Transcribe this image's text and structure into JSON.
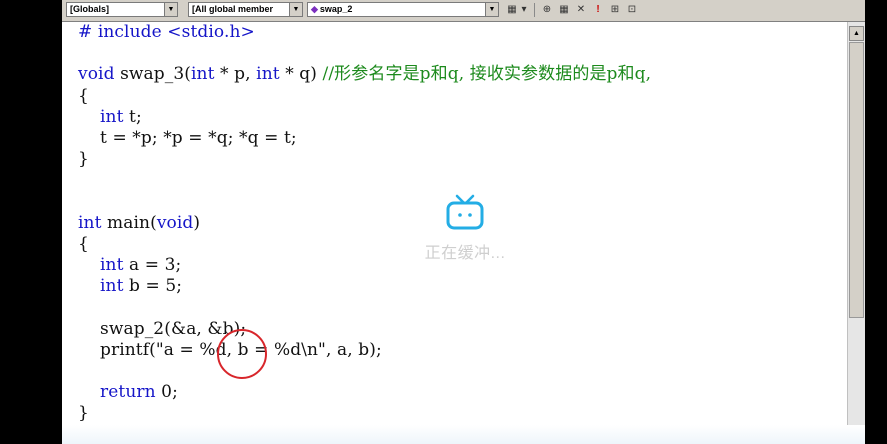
{
  "toolbar": {
    "scope_combo": "[Globals]",
    "members_combo": "[All global member",
    "function_combo": "swap_2",
    "dropdown_glyph": "▼",
    "function_icon_glyph": "◆",
    "dropdown_btn_glyph": "▾",
    "btn_glyphs": [
      "⊕",
      "▦",
      "✕",
      "!",
      "⊞",
      "⊡"
    ]
  },
  "editor": {
    "code_lines": [
      [
        {
          "t": "# include <stdio.h>",
          "k": "kw"
        }
      ],
      [
        {
          "t": "",
          "k": ""
        }
      ],
      [
        {
          "t": "void",
          "k": "kw"
        },
        {
          "t": " swap_3(",
          "k": ""
        },
        {
          "t": "int",
          "k": "kw"
        },
        {
          "t": " * p, ",
          "k": ""
        },
        {
          "t": "int",
          "k": "kw"
        },
        {
          "t": " * q) ",
          "k": ""
        },
        {
          "t": "//形参名字是p和q, 接收实参数据的是p和q,",
          "k": "cm"
        }
      ],
      [
        {
          "t": "{",
          "k": ""
        }
      ],
      [
        {
          "t": "    ",
          "k": ""
        },
        {
          "t": "int",
          "k": "kw"
        },
        {
          "t": " t;",
          "k": ""
        }
      ],
      [
        {
          "t": "    t = *p; *p = *q; *q = t;",
          "k": ""
        }
      ],
      [
        {
          "t": "}",
          "k": ""
        }
      ],
      [
        {
          "t": "",
          "k": ""
        }
      ],
      [
        {
          "t": "",
          "k": ""
        }
      ],
      [
        {
          "t": "int",
          "k": "kw"
        },
        {
          "t": " main(",
          "k": ""
        },
        {
          "t": "void",
          "k": "kw"
        },
        {
          "t": ")",
          "k": ""
        }
      ],
      [
        {
          "t": "{",
          "k": ""
        }
      ],
      [
        {
          "t": "    ",
          "k": ""
        },
        {
          "t": "int",
          "k": "kw"
        },
        {
          "t": " a = 3;",
          "k": ""
        }
      ],
      [
        {
          "t": "    ",
          "k": ""
        },
        {
          "t": "int",
          "k": "kw"
        },
        {
          "t": " b = 5;",
          "k": ""
        }
      ],
      [
        {
          "t": "",
          "k": ""
        }
      ],
      [
        {
          "t": "    swap_2(&a, &b);",
          "k": ""
        }
      ],
      [
        {
          "t": "    printf(\"a = %d, b = %d\\n\", a, b);",
          "k": ""
        }
      ],
      [
        {
          "t": "",
          "k": ""
        }
      ],
      [
        {
          "t": "    ",
          "k": ""
        },
        {
          "t": "return",
          "k": "kw"
        },
        {
          "t": " 0;",
          "k": ""
        }
      ],
      [
        {
          "t": "}",
          "k": ""
        }
      ]
    ]
  },
  "scrollbar": {
    "up_glyph": "▲"
  },
  "overlay": {
    "buffering_text": "正在缓冲..."
  },
  "colors": {
    "keyword": "#1515c8",
    "comment": "#1c8a1c",
    "annotation_circle": "#d8262b",
    "tv_icon": "#23ade5"
  }
}
